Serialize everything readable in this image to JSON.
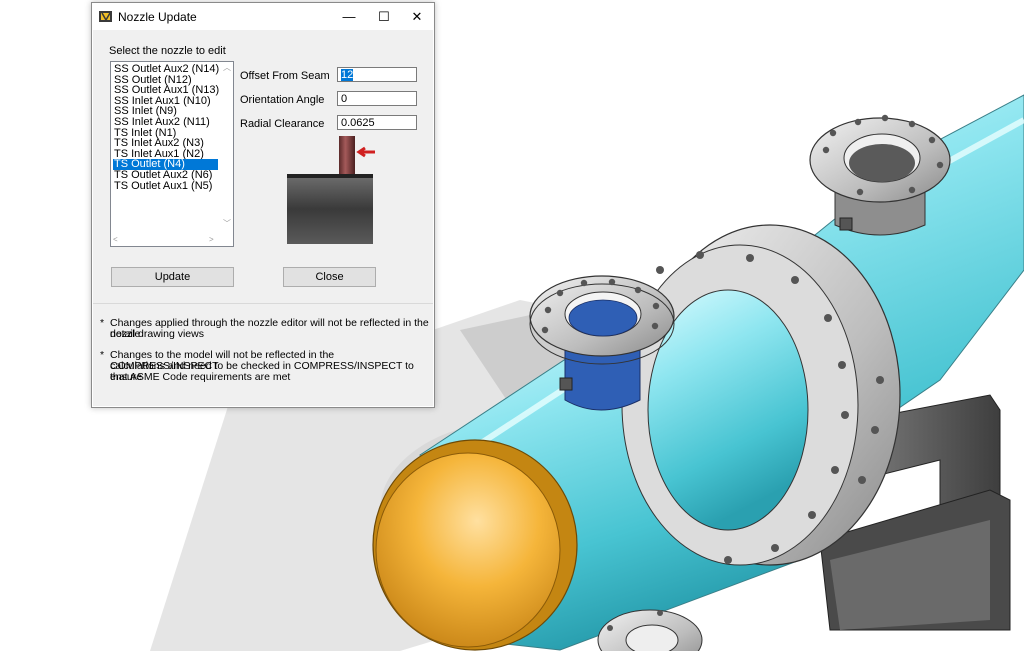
{
  "dialog": {
    "title": "Nozzle Update",
    "window_controls": {
      "minimize": "—",
      "maximize": "☐",
      "close": "✕"
    },
    "select_label": "Select the nozzle to edit",
    "nozzles": [
      {
        "label": "SS Outlet Aux2 (N14)",
        "selected": false
      },
      {
        "label": "SS Outlet (N12)",
        "selected": false
      },
      {
        "label": "SS Outlet Aux1 (N13)",
        "selected": false
      },
      {
        "label": "SS Inlet Aux1 (N10)",
        "selected": false
      },
      {
        "label": "SS Inlet (N9)",
        "selected": false
      },
      {
        "label": "SS Inlet Aux2 (N11)",
        "selected": false
      },
      {
        "label": "TS Inlet (N1)",
        "selected": false
      },
      {
        "label": "TS Inlet Aux2 (N3)",
        "selected": false
      },
      {
        "label": "TS Inlet Aux1 (N2)",
        "selected": false
      },
      {
        "label": "TS Outlet (N4)",
        "selected": true
      },
      {
        "label": "TS Outlet Aux2 (N6)",
        "selected": false
      },
      {
        "label": "TS Outlet Aux1 (N5)",
        "selected": false
      }
    ],
    "fields": {
      "offset": {
        "label": "Offset From Seam",
        "value": "12"
      },
      "angle": {
        "label": "Orientation Angle",
        "value": "0"
      },
      "clearance": {
        "label": "Radial Clearance",
        "value": "0.0625"
      }
    },
    "buttons": {
      "update": "Update",
      "close": "Close"
    },
    "notes": [
      {
        "bullet": "*",
        "lines": [
          "Changes applied through the nozzle editor will not be reflected in the nozzle",
          "detail drawing views"
        ]
      },
      {
        "bullet": "*",
        "lines": [
          "Changes to the model will not be reflected in the COMPRESS/INSPECT",
          "calculations and need to be checked in COMPRESS/INSPECT to ensure",
          "that ASME Code requirements are met"
        ]
      }
    ]
  },
  "colors": {
    "shell": "#9fe8f0",
    "head": "#f2a82a",
    "flange": "#c8c8c8",
    "highlighted_nozzle": "#2f5fb5",
    "selection": "#0078d7"
  }
}
